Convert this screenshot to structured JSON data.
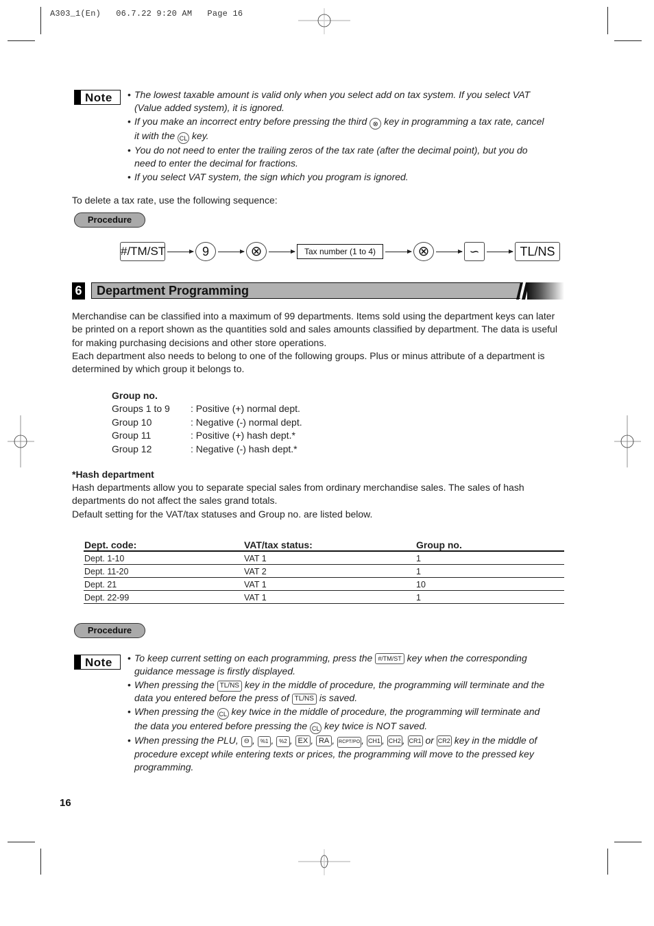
{
  "print_slug": "A303_1(En)   06.7.22 9:20 AM   Page 16",
  "note1": {
    "badge": "Note",
    "items": [
      [
        "The lowest taxable amount is valid only when you select add on tax system. If you select VAT",
        "(Value added system), it is ignored."
      ],
      [
        "If you make an incorrect entry before pressing the third",
        "key in programming a tax rate, cancel",
        "it with the",
        "key."
      ],
      [
        "You do not need to enter the trailing zeros of the tax rate (after the decimal point), but you do",
        "need to enter the decimal for fractions."
      ],
      [
        "If you select VAT system, the sign which you program is ignored."
      ]
    ],
    "keys": {
      "multiply": "⊗",
      "cl": "CL"
    }
  },
  "delete_intro": "To delete a tax rate, use the following sequence:",
  "procedure_label": "Procedure",
  "sequence": [
    {
      "type": "rect",
      "label": "#/TM/ST"
    },
    {
      "type": "circle",
      "label": "9"
    },
    {
      "type": "circle",
      "label": "⊗"
    },
    {
      "type": "box",
      "label": "Tax number (1 to 4)"
    },
    {
      "type": "circle",
      "label": "⊗"
    },
    {
      "type": "rect",
      "label": "∽"
    },
    {
      "type": "rect",
      "label": "TL/NS"
    }
  ],
  "section": {
    "number": "6",
    "title": "Department Programming"
  },
  "intro_paragraphs": [
    "Merchandise can be classified into a maximum of 99 departments.  Items sold using the department keys can later be printed on a report shown as the quantities sold and sales amounts classified by department.  The data is useful for making purchasing decisions and other store operations.",
    "Each department also needs to belong to one of the following groups. Plus or minus attribute of a department is determined by which group it belongs to."
  ],
  "groups": {
    "heading": "Group no.",
    "rows": [
      {
        "group": "Groups 1 to 9",
        "desc": ": Positive (+) normal dept."
      },
      {
        "group": "Group 10",
        "desc": ": Negative (-) normal dept."
      },
      {
        "group": "Group 11",
        "desc": ": Positive (+) hash dept.*"
      },
      {
        "group": "Group 12",
        "desc": ": Negative (-) hash dept.*"
      }
    ]
  },
  "hash": {
    "heading": "*Hash department",
    "text1": "Hash departments allow you to separate special sales from ordinary merchandise sales. The sales of hash departments do not affect the sales grand totals.",
    "text2": "Default setting for the VAT/tax statuses and Group no. are listed below."
  },
  "dept_table": {
    "headers": [
      "Dept. code:",
      "VAT/tax status:",
      "Group no."
    ],
    "rows": [
      [
        "Dept. 1-10",
        "VAT 1",
        "1"
      ],
      [
        "Dept. 11-20",
        "VAT 2",
        "1"
      ],
      [
        "Dept. 21",
        "VAT 1",
        "10"
      ],
      [
        "Dept. 22-99",
        "VAT 1",
        "1"
      ]
    ]
  },
  "note2": {
    "badge": "Note",
    "item1": {
      "a": "To keep current setting on each programming, press the",
      "key": "#/TM/ST",
      "b": "key when the corresponding",
      "c": "guidance message is firstly displayed."
    },
    "item2": {
      "a": "When pressing the",
      "key": "TL/NS",
      "b": "key in the middle of procedure, the programming will terminate and the",
      "c": "data you entered before the press of",
      "d": "is saved."
    },
    "item3": {
      "a": "When pressing the",
      "key": "CL",
      "b": "key twice in the middle of procedure, the programming will terminate and",
      "c": "the data you entered before pressing the",
      "d": "key twice is NOT saved."
    },
    "item4": {
      "a": "When pressing the PLU,",
      "keys": [
        "⊖",
        "%1",
        "%2",
        "EX",
        "RA",
        "RCPT/PO",
        "CH1",
        "CH2",
        "CR1"
      ],
      "or": "or",
      "last_key": "CR2",
      "b": "key in the middle of",
      "c": "procedure except while entering texts or prices, the programming will move to the pressed key",
      "d": "programming."
    }
  },
  "page_number": "16"
}
